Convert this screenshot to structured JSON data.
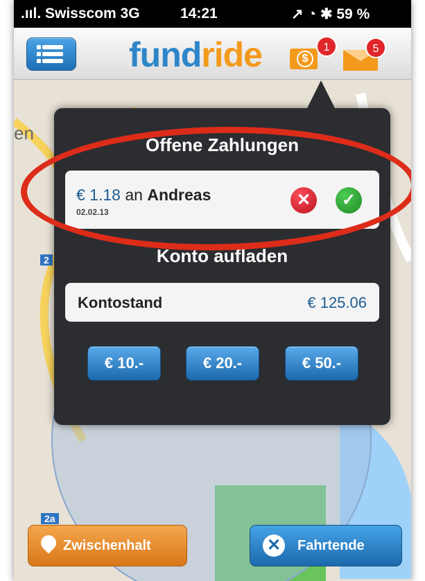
{
  "status": {
    "carrier": ".ııl. Swisscom 3G",
    "time": "14:21",
    "right": "↗ ◔ ✱ 59 %"
  },
  "nav": {
    "logo_a": "fund",
    "logo_b": "ride",
    "money_badge": "1",
    "mail_badge": "5"
  },
  "popup": {
    "title": "Offene Zahlungen",
    "payment": {
      "amount": "€ 1.18",
      "connector": "an",
      "name": "Andreas",
      "date": "02.02.13"
    },
    "section_title": "Konto aufladen",
    "balance": {
      "label": "Kontostand",
      "value": "€ 125.06"
    },
    "buttons": [
      "€ 10.-",
      "€ 20.-",
      "€ 50.-"
    ]
  },
  "bottom": {
    "stop_label": "Zwischenhalt",
    "end_label": "Fahrtende"
  },
  "map_labels": {
    "left_label": "en",
    "road_a": "2",
    "road_b": "2a"
  },
  "colors": {
    "accent_blue": "#2e86c8",
    "brand_orange": "#f39a1c",
    "highlight_red": "#dd2c19"
  }
}
